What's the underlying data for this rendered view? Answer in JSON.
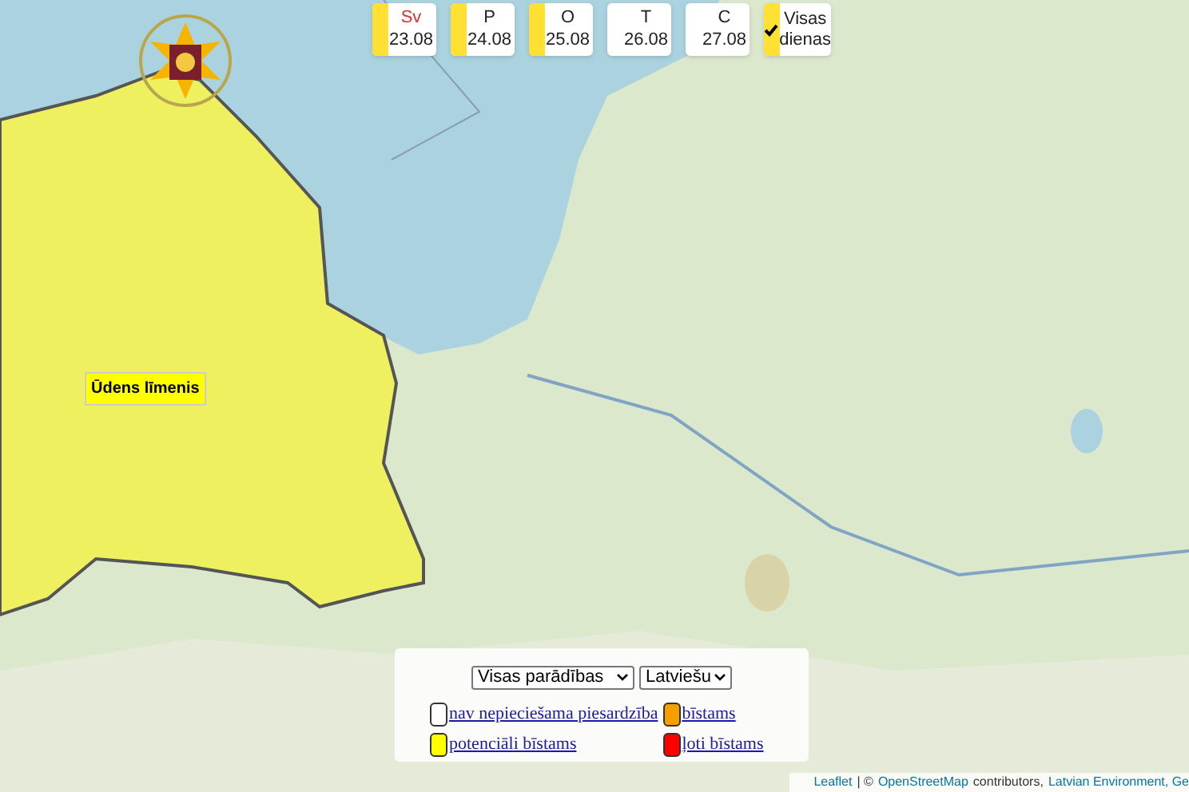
{
  "days": [
    {
      "weekday": "Sv",
      "date": "23.08",
      "weekend": true,
      "color": "#ffe033"
    },
    {
      "weekday": "P",
      "date": "24.08",
      "weekend": false,
      "color": "#ffe033"
    },
    {
      "weekday": "O",
      "date": "25.08",
      "weekend": false,
      "color": "#ffe033"
    },
    {
      "weekday": "T",
      "date": "26.08",
      "weekend": false
    },
    {
      "weekday": "C",
      "date": "27.08",
      "weekend": false
    }
  ],
  "all_days": {
    "label": "Visas dienas",
    "checked": true,
    "color": "#ffe033"
  },
  "region_label": "Ūdens līmenis",
  "legend": {
    "filter_select": "Visas parādības",
    "language_select": "Latviešu",
    "items": [
      {
        "label": "nav nepieciešama piesardzība",
        "color": "#ffffff"
      },
      {
        "label": "bīstams",
        "color": "#f5a000"
      },
      {
        "label": "potenciāli bīstams",
        "color": "#ffff00"
      },
      {
        "label": "ļoti bīstams",
        "color": "#ff0000"
      }
    ]
  },
  "attribution": [
    {
      "kind": "link",
      "text": "Leaflet"
    },
    {
      "kind": "text",
      "text": "| © "
    },
    {
      "kind": "link",
      "text": "OpenStreetMap"
    },
    {
      "kind": "text",
      "text": "contributors,"
    },
    {
      "kind": "link",
      "text": "Latvian Environment, Ge"
    }
  ]
}
